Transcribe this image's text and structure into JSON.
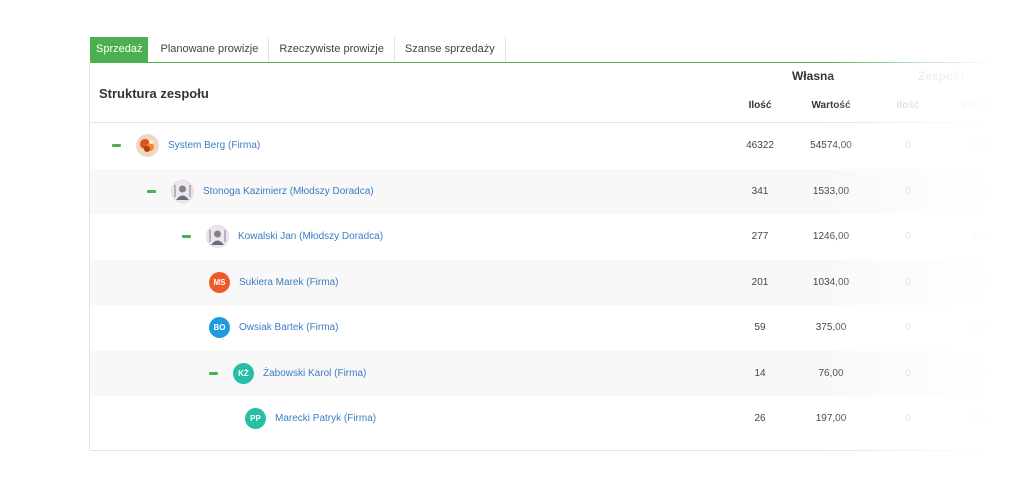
{
  "tabs": [
    "Sprzedaż",
    "Planowane prowizje",
    "Rzeczywiste prowizje",
    "Szanse sprzedaży"
  ],
  "header": {
    "structure_title": "Struktura zespołu",
    "own_group": "Własna",
    "team_group": "Zespołu",
    "qty": "Ilość",
    "value": "Wartość"
  },
  "colors": {
    "accent": "#4caf50",
    "link": "#3b7dc4",
    "avatar_orange": "#ef5a28",
    "avatar_blue": "#1e9be0",
    "avatar_teal": "#26bfa5"
  },
  "rows": [
    {
      "name": "System Berg (Firma)",
      "level": 0,
      "toggle": true,
      "avatar": "photo-food",
      "qty": "46322",
      "value": "54574,00",
      "team_qty": "0",
      "team_value": "0,00"
    },
    {
      "name": "Stonoga Kazimierz (Młodszy Doradca)",
      "level": 1,
      "toggle": true,
      "avatar": "photo-person",
      "qty": "341",
      "value": "1533,00",
      "team_qty": "0",
      "team_value": "0,00"
    },
    {
      "name": "Kowalski Jan (Młodszy Doradca)",
      "level": 2,
      "toggle": true,
      "avatar": "photo-person",
      "qty": "277",
      "value": "1246,00",
      "team_qty": "0",
      "team_value": "0,00"
    },
    {
      "name": "Sukiera Marek (Firma)",
      "level": 3,
      "toggle": false,
      "avatar_initials": "MS",
      "avatar_color": "#ef5a28",
      "qty": "201",
      "value": "1034,00",
      "team_qty": "0",
      "team_value": "0,00"
    },
    {
      "name": "Owsiak Bartek (Firma)",
      "level": 3,
      "toggle": false,
      "avatar_initials": "BO",
      "avatar_color": "#1e9be0",
      "qty": "59",
      "value": "375,00",
      "team_qty": "0",
      "team_value": "0,00"
    },
    {
      "name": "Żabowski Karol (Firma)",
      "level": 3,
      "toggle": true,
      "avatar_initials": "KŻ",
      "avatar_color": "#26bfa5",
      "qty": "14",
      "value": "76,00",
      "team_qty": "0",
      "team_value": "0,00"
    },
    {
      "name": "Marecki Patryk (Firma)",
      "level": 4,
      "toggle": false,
      "avatar_initials": "PP",
      "avatar_color": "#26bfa5",
      "qty": "26",
      "value": "197,00",
      "team_qty": "0",
      "team_value": "0,00"
    }
  ]
}
